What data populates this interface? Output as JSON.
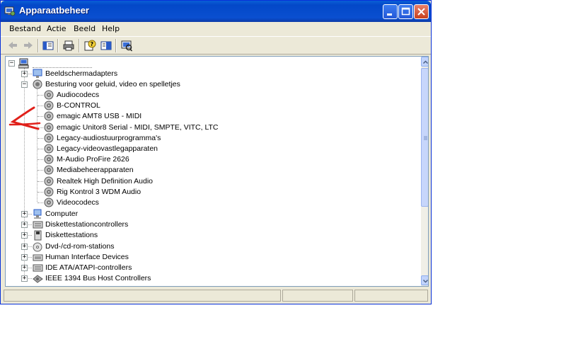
{
  "window": {
    "title": "Apparaatbeheer"
  },
  "menu": [
    {
      "label": "Bestand"
    },
    {
      "label": "Actie"
    },
    {
      "label": "Beeld"
    },
    {
      "label": "Help"
    }
  ],
  "tree": {
    "root_label": "",
    "categories_top": [
      {
        "label": "Beeldschermadapters",
        "icon": "display-adapter-icon",
        "expanded": false
      },
      {
        "label": "Besturing voor geluid, video en spelletjes",
        "icon": "sound-icon",
        "expanded": true
      }
    ],
    "sound_devices": [
      "Audiocodecs",
      "B-CONTROL",
      "emagic AMT8 USB - MIDI",
      "emagic Unitor8 Serial - MIDI, SMPTE, VITC, LTC",
      "Legacy-audiostuurprogramma's",
      "Legacy-videovastlegapparaten",
      "M-Audio ProFire 2626",
      "Mediabeheerapparaten",
      "Realtek High Definition Audio",
      "Rig Kontrol 3 WDM Audio",
      "Videocodecs"
    ],
    "categories_bottom": [
      {
        "label": "Computer",
        "icon": "computer-icon"
      },
      {
        "label": "Diskettestationcontrollers",
        "icon": "floppy-controller-icon"
      },
      {
        "label": "Diskettestations",
        "icon": "floppy-drive-icon"
      },
      {
        "label": "Dvd-/cd-rom-stations",
        "icon": "cdrom-icon"
      },
      {
        "label": "Human Interface Devices",
        "icon": "hid-icon"
      },
      {
        "label": "IDE ATA/ATAPI-controllers",
        "icon": "ide-controller-icon"
      },
      {
        "label": "IEEE 1394 Bus Host Controllers",
        "icon": "ieee1394-icon"
      }
    ]
  },
  "colors": {
    "titlebar": "#0348c8",
    "annotation": "#e0201a"
  }
}
